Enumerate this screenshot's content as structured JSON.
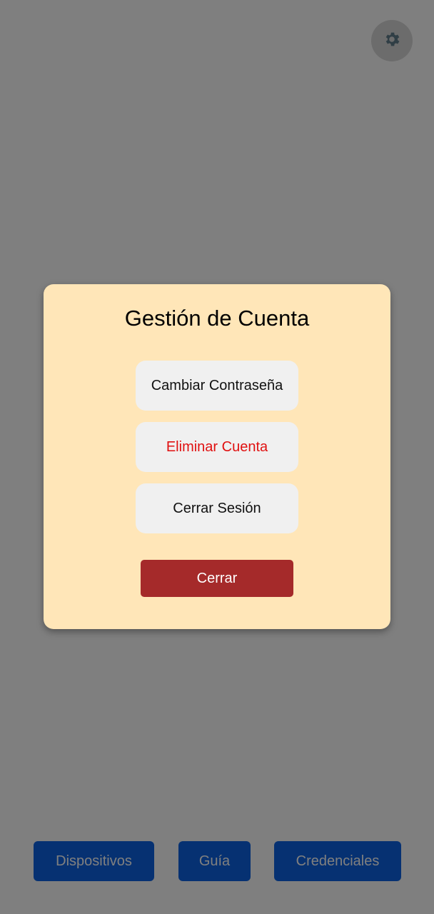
{
  "header": {
    "settings_icon": "gear-icon"
  },
  "bottom_nav": {
    "items": [
      {
        "label": "Dispositivos"
      },
      {
        "label": "Guía"
      },
      {
        "label": "Credenciales"
      }
    ]
  },
  "modal": {
    "title": "Gestión de Cuenta",
    "options": [
      {
        "label": "Cambiar Contraseña"
      },
      {
        "label": "Eliminar Cuenta"
      },
      {
        "label": "Cerrar Sesión"
      }
    ],
    "close_label": "Cerrar"
  },
  "colors": {
    "overlay": "#808080",
    "modal_background": "#ffe6b8",
    "option_background": "#f0f0f0",
    "danger_text": "#e01010",
    "close_button": "#a52a2a",
    "nav_button": "#0d63e4"
  }
}
